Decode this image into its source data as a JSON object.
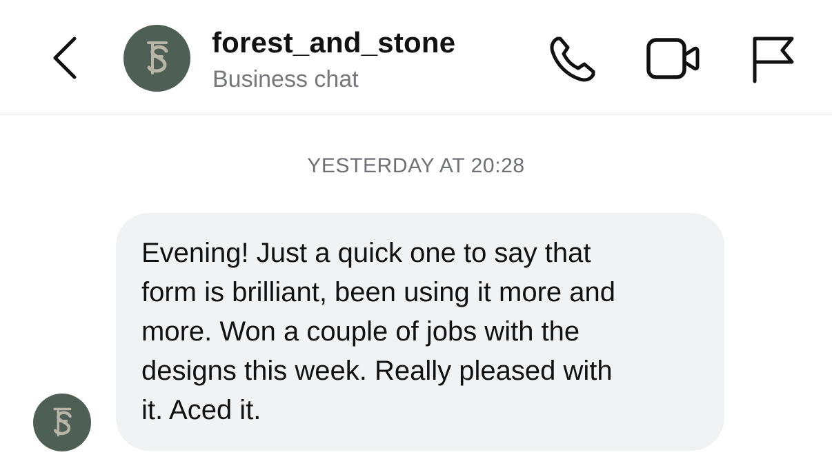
{
  "header": {
    "title": "forest_and_stone",
    "subtitle": "Business chat",
    "avatar_monogram": "SF",
    "icons": {
      "back": "chevron-left-icon",
      "call": "phone-icon",
      "video": "video-camera-icon",
      "report": "flag-icon"
    }
  },
  "conversation": {
    "timestamp": "YESTERDAY AT 20:28",
    "messages": [
      {
        "text": "Evening! Just a quick one to say that\nform is brilliant, been using it more and\nmore. Won a couple of jobs with the\ndesigns this week. Really pleased with\nit. Aced it."
      }
    ]
  },
  "colors": {
    "avatar_bg": "#4e5f56",
    "avatar_mark": "#b9b5a6",
    "bubble_bg": "#f1f2f4",
    "muted_text": "#75777c"
  }
}
